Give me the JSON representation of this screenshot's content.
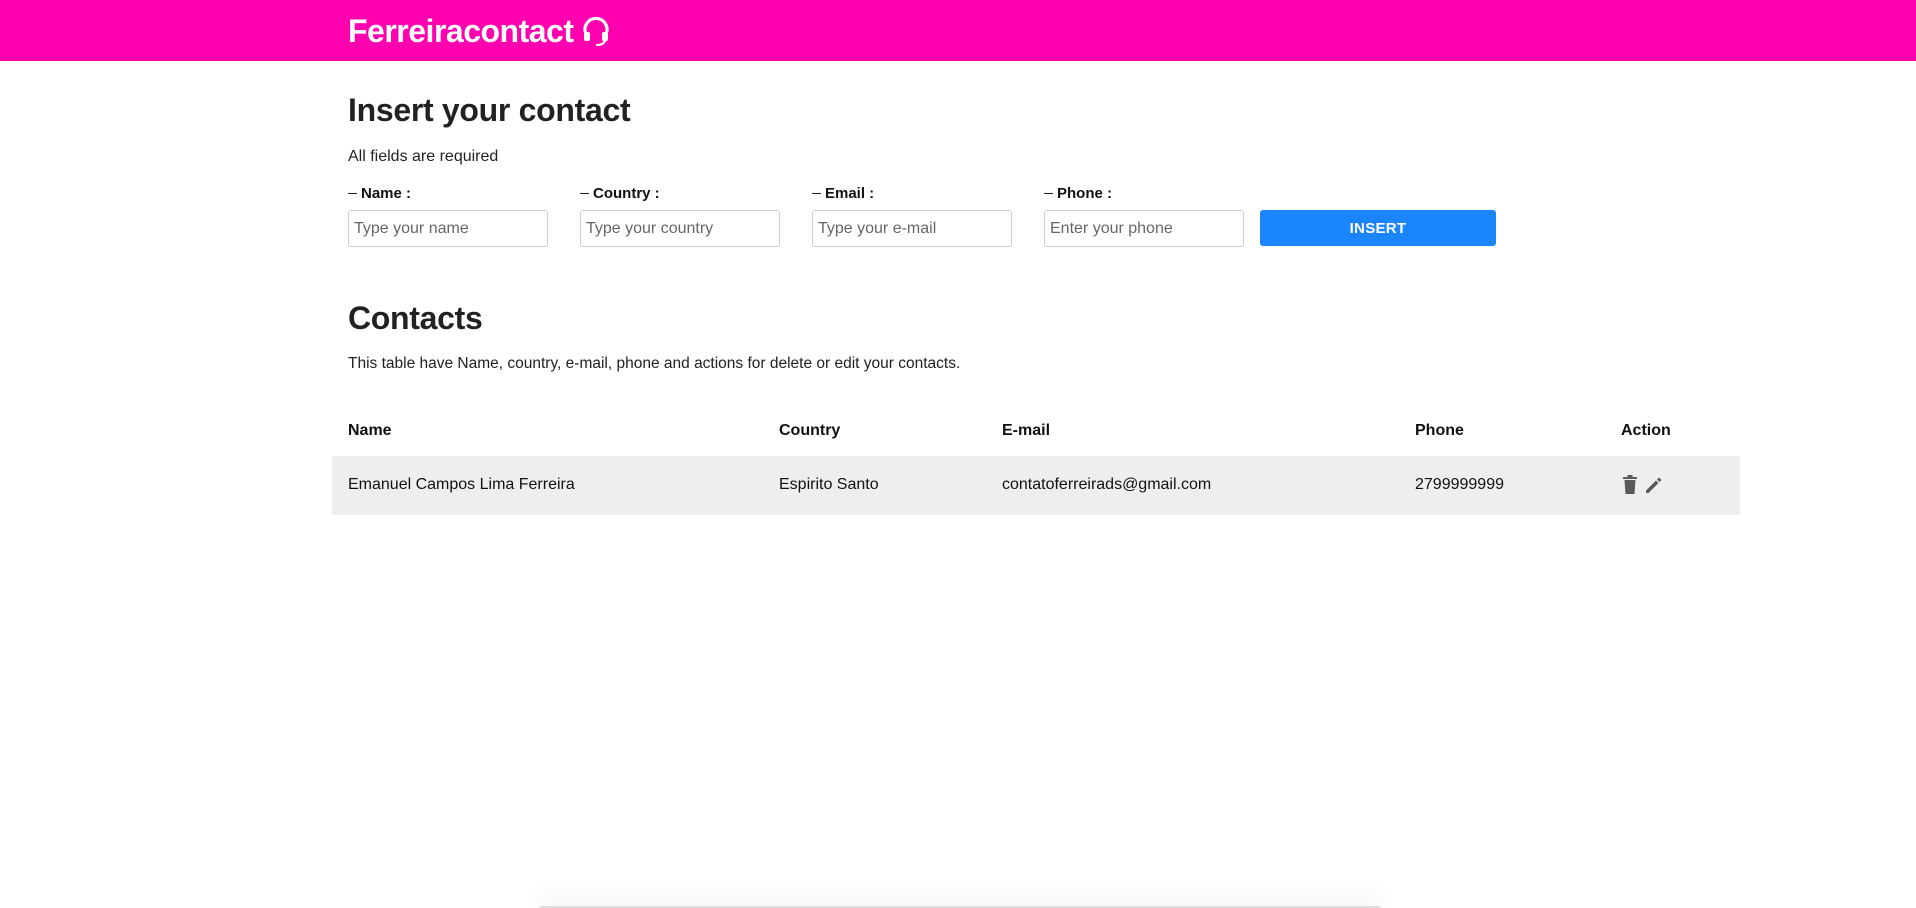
{
  "header": {
    "brand": "Ferreiracontact",
    "brand_icon": "headset-icon",
    "bg_color": "#ff00ae"
  },
  "insert_section": {
    "title": "Insert your contact",
    "subtitle": "All fields are required",
    "fields": [
      {
        "label": "Name :",
        "placeholder": "Type your name"
      },
      {
        "label": "Country :",
        "placeholder": "Type your country"
      },
      {
        "label": "Email :",
        "placeholder": "Type your e-mail"
      },
      {
        "label": "Phone :",
        "placeholder": "Enter your phone"
      }
    ],
    "insert_label": "INSERT",
    "insert_color": "#1a85ff"
  },
  "contacts_section": {
    "title": "Contacts",
    "description": "This table have Name, country, e-mail, phone and actions for delete or edit your contacts.",
    "columns": [
      "Name",
      "Country",
      "E-mail",
      "Phone",
      "Action"
    ],
    "rows": [
      {
        "name": "Emanuel Campos Lima Ferreira",
        "country": "Espirito Santo",
        "email": "contatoferreirads@gmail.com",
        "phone": "2799999999",
        "actions": [
          "delete-icon",
          "edit-icon"
        ]
      }
    ]
  }
}
